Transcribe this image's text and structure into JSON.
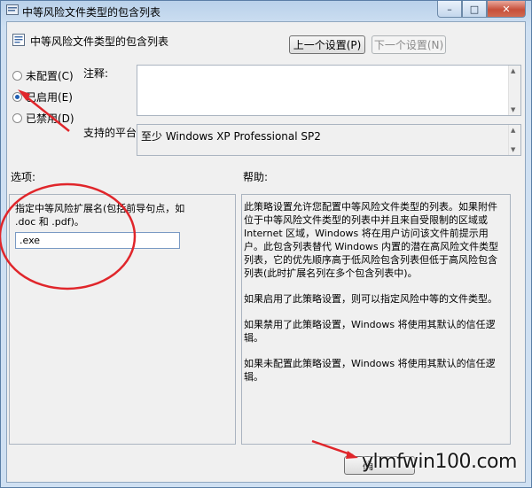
{
  "window": {
    "title": "中等风险文件类型的包含列表",
    "close_glyph": "✕",
    "maximize_glyph": "□",
    "minimize_glyph": "–"
  },
  "header": {
    "title": "中等风险文件类型的包含列表",
    "prev_button": "上一个设置(P)",
    "next_button": "下一个设置(N)"
  },
  "state_options": [
    {
      "label": "未配置(C)",
      "selected": false
    },
    {
      "label": "已启用(E)",
      "selected": true
    },
    {
      "label": "已禁用(D)",
      "selected": false
    }
  ],
  "comment": {
    "label": "注释:",
    "value": ""
  },
  "platform": {
    "label": "支持的平台:",
    "value": "至少 Windows XP Professional SP2"
  },
  "options": {
    "label": "选项:",
    "description": "指定中等风险扩展名(包括前导句点，如 .doc 和 .pdf)。",
    "extension_value": ".exe"
  },
  "help": {
    "label": "帮助:",
    "paragraphs": [
      "此策略设置允许您配置中等风险文件类型的列表。如果附件位于中等风险文件类型的列表中并且来自受限制的区域或 Internet 区域，Windows 将在用户访问该文件前提示用户。此包含列表替代 Windows 内置的潜在高风险文件类型列表，它的优先顺序高于低风险包含列表但低于高风险包含列表(此时扩展名列在多个包含列表中)。",
      "如果启用了此策略设置，则可以指定风险中等的文件类型。",
      "如果禁用了此策略设置，Windows 将使用其默认的信任逻辑。",
      "如果未配置此策略设置，Windows 将使用其默认的信任逻辑。"
    ]
  },
  "footer": {
    "ok_button_partial": "确"
  },
  "watermark": "ylmfwin100.com",
  "colors": {
    "annotation": "#e0262b",
    "title_bg": "#b9d1ea",
    "client_bg": "#f0f0f0"
  }
}
